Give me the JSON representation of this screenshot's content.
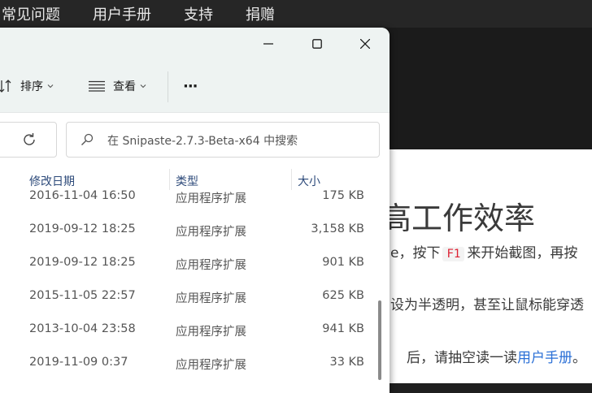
{
  "site": {
    "nav": [
      "常见问题",
      "用户手册",
      "支持",
      "捐赠"
    ],
    "heading": "高工作效率",
    "para1_prefix": "e，按下",
    "para1_key": "F1",
    "para1_suffix": "来开始截图，再按",
    "para2": "设为半透明，甚至让鼠标能穿透",
    "para3_prefix": "后，请抽空读一读",
    "para3_link": "用户手册",
    "para3_suffix": "。"
  },
  "window": {
    "toolbar": {
      "sort_label": "排序",
      "view_label": "查看",
      "more_label": "···"
    },
    "search_placeholder": "在 Snipaste-2.7.3-Beta-x64 中搜索",
    "columns": {
      "date": "修改日期",
      "type": "类型",
      "size": "大小"
    },
    "files": [
      {
        "date": "2016-11-04 16:50",
        "type": "应用程序扩展",
        "size": "175 KB"
      },
      {
        "date": "2019-09-12 18:25",
        "type": "应用程序扩展",
        "size": "3,158 KB"
      },
      {
        "date": "2019-09-12 18:25",
        "type": "应用程序扩展",
        "size": "901 KB"
      },
      {
        "date": "2015-11-05 22:57",
        "type": "应用程序扩展",
        "size": "625 KB"
      },
      {
        "date": "2013-10-04 23:58",
        "type": "应用程序扩展",
        "size": "941 KB"
      },
      {
        "date": "2019-11-09 0:37",
        "type": "应用程序扩展",
        "size": "33 KB"
      }
    ]
  },
  "colors": {
    "title_bg": "#eef3f2",
    "header_text": "#2d4a7a",
    "link": "#2a6fd6",
    "key_text": "#dd2233"
  },
  "icons": [
    "sort-icon",
    "view-icon",
    "refresh-icon",
    "search-icon",
    "minimize-icon",
    "maximize-icon",
    "close-icon",
    "chevron-down-icon"
  ]
}
